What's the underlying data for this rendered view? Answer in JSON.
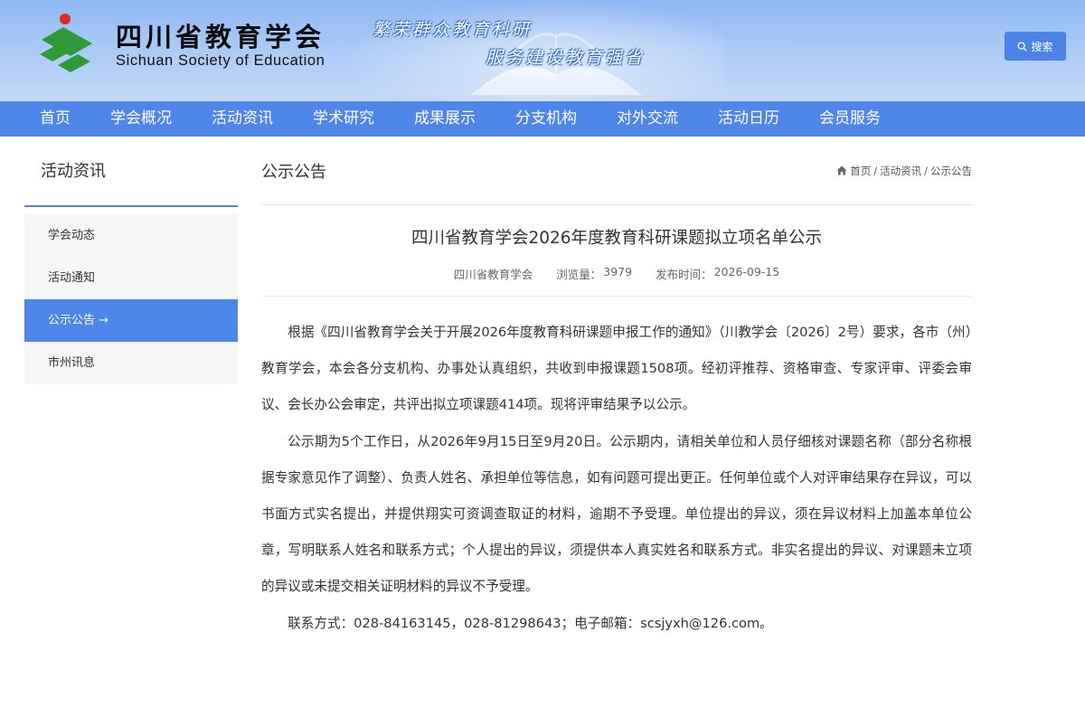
{
  "brand": {
    "name_cn": "四川省教育学会",
    "name_en": "Sichuan Society of Education",
    "slogan_line1": "繁荣群众教育科研",
    "slogan_line2": "服务建设教育强省",
    "logo_colors": {
      "green": "#2f9a3a",
      "red": "#e0281c"
    }
  },
  "search": {
    "label": "搜索",
    "icon": "search-icon"
  },
  "nav": {
    "items": [
      {
        "label": "首页"
      },
      {
        "label": "学会概况"
      },
      {
        "label": "活动资讯"
      },
      {
        "label": "学术研究"
      },
      {
        "label": "成果展示"
      },
      {
        "label": "分支机构"
      },
      {
        "label": "对外交流"
      },
      {
        "label": "活动日历"
      },
      {
        "label": "会员服务"
      }
    ]
  },
  "sidebar": {
    "title": "活动资讯",
    "items": [
      {
        "label": "学会动态",
        "active": false
      },
      {
        "label": "活动通知",
        "active": false
      },
      {
        "label": "公示公告 →",
        "active": true
      },
      {
        "label": "市州讯息",
        "active": false
      }
    ]
  },
  "main": {
    "section_title": "公示公告",
    "breadcrumb": {
      "home": "首页",
      "sep1": "/",
      "level1": "活动资讯",
      "sep2": "/",
      "level2": "公示公告"
    }
  },
  "article": {
    "title": "四川省教育学会2026年度教育科研课题拟立项名单公示",
    "source": "四川省教育学会",
    "views_label": "浏览量：",
    "views_value": "3979",
    "date_label": "发布时间：",
    "date_value": "2026-09-15",
    "paragraphs": [
      "根据《四川省教育学会关于开展2026年度教育科研课题申报工作的通知》（川教学会〔2026〕2号）要求，各市（州）教育学会，本会各分支机构、办事处认真组织，共收到申报课题1508项。经初评推荐、资格审查、专家评审、评委会审议、会长办公会审定，共评出拟立项课题414项。现将评审结果予以公示。",
      "公示期为5个工作日，从2026年9月15日至9月20日。公示期内，请相关单位和人员仔细核对课题名称（部分名称根据专家意见作了调整）、负责人姓名、承担单位等信息，如有问题可提出更正。任何单位或个人对评审结果存在异议，可以书面方式实名提出，并提供翔实可资调查取证的材料，逾期不予受理。单位提出的异议，须在异议材料上加盖本单位公章，写明联系人姓名和联系方式；个人提出的异议，须提供本人真实姓名和联系方式。非实名提出的异议、对课题未立项的异议或未提交相关证明材料的异议不予受理。",
      "联系方式：028-84163145，028-81298643；电子邮箱：scsjyxh@126.com。"
    ]
  },
  "colors": {
    "accent": "#4f86e9",
    "sidebar_bg": "#f5f6f8"
  }
}
